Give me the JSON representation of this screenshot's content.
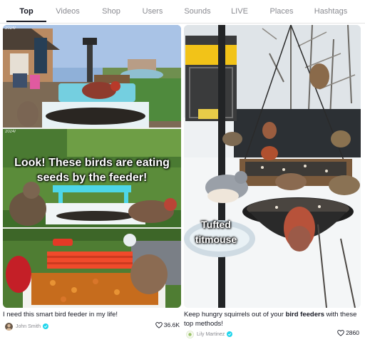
{
  "tabs": [
    {
      "label": "Top",
      "active": true
    },
    {
      "label": "Videos",
      "active": false
    },
    {
      "label": "Shop",
      "active": false
    },
    {
      "label": "Users",
      "active": false
    },
    {
      "label": "Sounds",
      "active": false
    },
    {
      "label": "LIVE",
      "active": false
    },
    {
      "label": "Places",
      "active": false
    },
    {
      "label": "Hashtags",
      "active": false
    }
  ],
  "results": [
    {
      "overlay_caption": "Look! These birds are eating seeds by the feeder!",
      "stamp_top": "2024/",
      "stamp_mid": "2024/",
      "description": "I need this smart bird feeder in my life!",
      "author": "John Smith",
      "likes": "36.6K"
    },
    {
      "overlay_caption": "Tufted titmouse",
      "description_before": "Keep hungry squirrels out of your ",
      "description_bold": "bird feeders",
      "description_after": " with these top methods!",
      "author": "Lily Martinez",
      "likes": "2860"
    }
  ],
  "icons": {
    "verified": "verified-badge-icon",
    "likes": "heart-icon"
  },
  "colors": {
    "active_tab": "#161823",
    "inactive_tab": "#8a8b91",
    "verified": "#20d5ec"
  }
}
